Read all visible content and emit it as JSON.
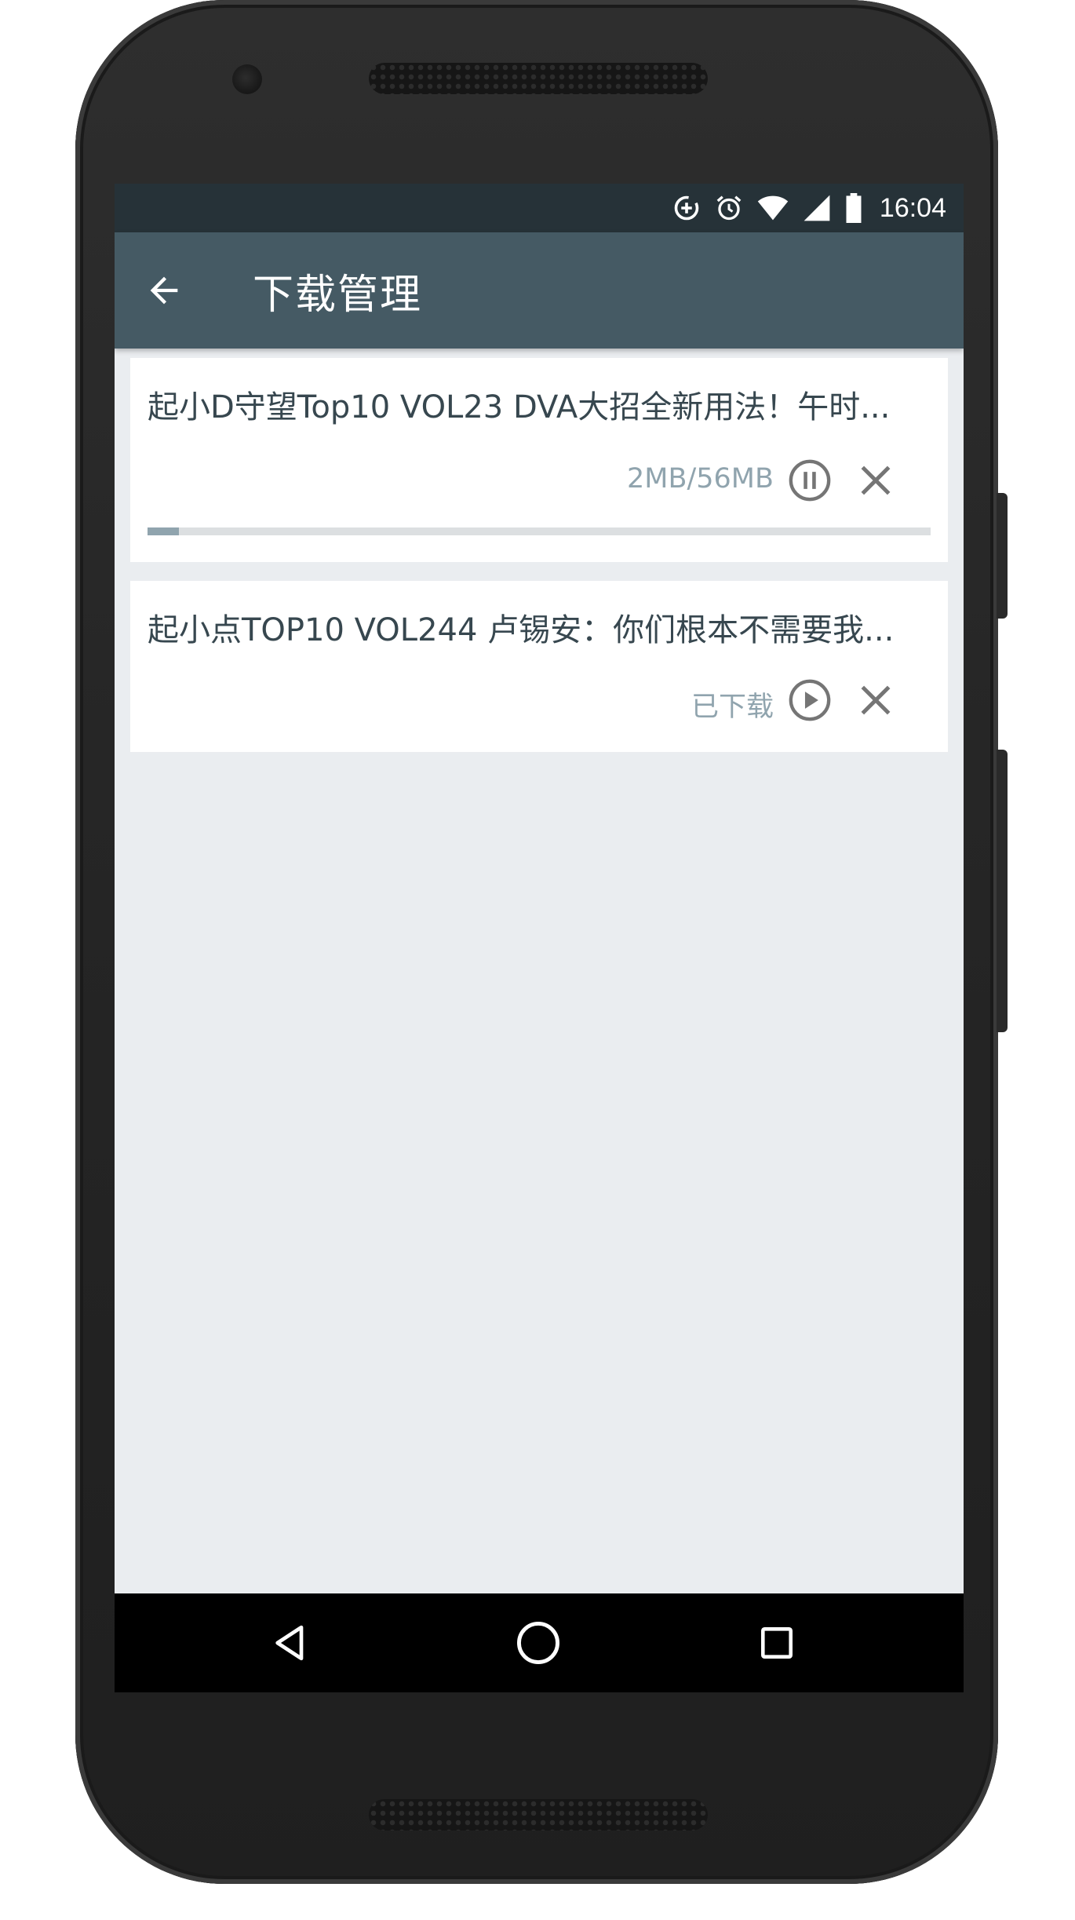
{
  "status_bar": {
    "time": "16:04",
    "icons": [
      "data-saver-icon",
      "alarm-icon",
      "wifi-icon",
      "signal-icon",
      "battery-icon"
    ]
  },
  "app_bar": {
    "back_icon": "arrow-back-icon",
    "title": "下载管理"
  },
  "downloads": [
    {
      "title": "起小D守望Top10 VOL23  DVA大招全新用法！午时...",
      "status": "2MB/56MB",
      "state": "downloading",
      "progress": 0.04,
      "toggle_icon": "pause-circle-icon",
      "remove_icon": "close-icon"
    },
    {
      "title": "起小点TOP10 VOL244 卢锡安：你们根本不需要我...",
      "status": "已下载",
      "state": "downloaded",
      "toggle_icon": "play-circle-icon",
      "remove_icon": "close-icon"
    }
  ],
  "nav_bar": {
    "icons": [
      "nav-back-icon",
      "nav-home-icon",
      "nav-recents-icon"
    ]
  },
  "colors": {
    "status_bar": "#263238",
    "app_bar": "#455a64",
    "background": "#eaedf0",
    "card": "#ffffff",
    "title_text": "#37474f",
    "status_text": "#90a4ae",
    "progress_fill": "#90a4ae",
    "progress_track": "#dcdfe1",
    "icon": "#757575"
  }
}
